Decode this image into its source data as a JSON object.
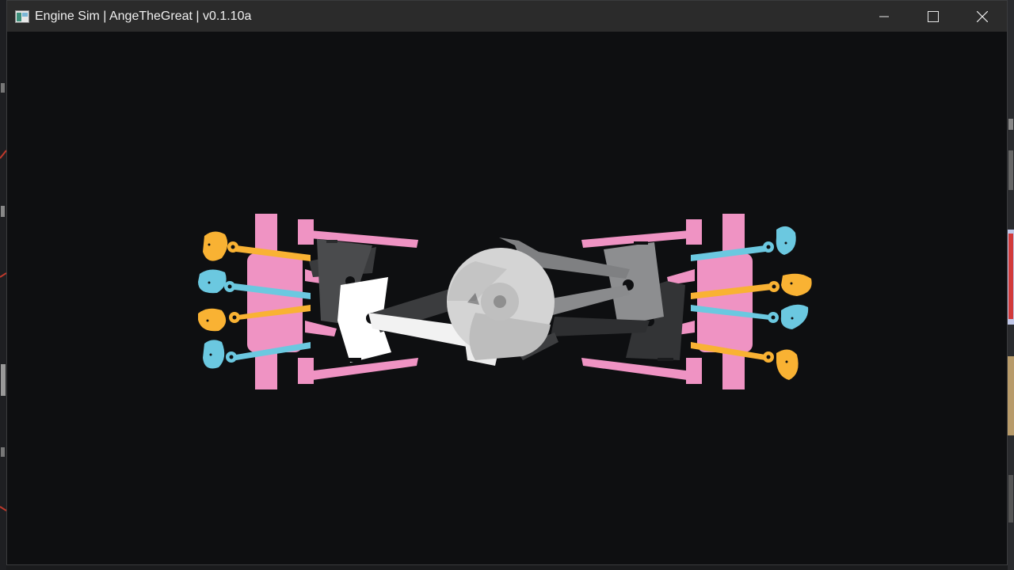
{
  "window": {
    "title": "Engine Sim | AngeTheGreat | v0.1.10a"
  },
  "controls": {
    "minimize_icon": "minimize-icon",
    "maximize_icon": "maximize-icon",
    "close_icon": "close-icon"
  },
  "colors": {
    "background": "#0e0f11",
    "titlebar": "#2b2b2b",
    "head": "#ef93c3",
    "intake": "#f9b233",
    "exhaust": "#6bc8e0",
    "piston_light": "#ffffff",
    "piston_dark": "#4a4b4d",
    "crank": "#d4d4d4"
  }
}
